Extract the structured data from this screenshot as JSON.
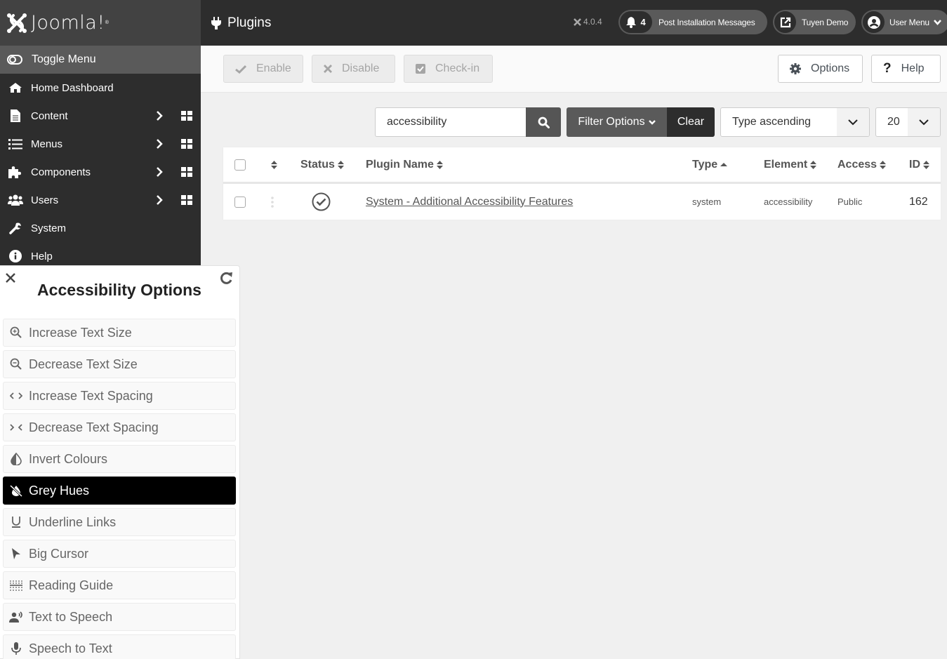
{
  "brand": {
    "name": "Joomla!",
    "reg": "®"
  },
  "sidebar": {
    "toggle_label": "Toggle Menu",
    "items": [
      {
        "label": "Home Dashboard",
        "icon": "home-icon",
        "submenu": false
      },
      {
        "label": "Content",
        "icon": "file-icon",
        "submenu": true
      },
      {
        "label": "Menus",
        "icon": "list-icon",
        "submenu": true
      },
      {
        "label": "Components",
        "icon": "puzzle-icon",
        "submenu": true
      },
      {
        "label": "Users",
        "icon": "users-icon",
        "submenu": true
      },
      {
        "label": "System",
        "icon": "wrench-icon",
        "submenu": false
      },
      {
        "label": "Help",
        "icon": "info-icon",
        "submenu": false
      }
    ]
  },
  "header": {
    "title": "Plugins",
    "title_icon": "plug-icon",
    "version": "4.0.4",
    "post_install": {
      "count": "4",
      "label": "Post Installation Messages"
    },
    "site_link": "Tuyen Demo",
    "user_menu": "User Menu"
  },
  "toolbar": {
    "enable": "Enable",
    "disable": "Disable",
    "checkin": "Check-in",
    "options": "Options",
    "help": "Help"
  },
  "filters": {
    "search_value": "accessibility",
    "filter_options": "Filter Options",
    "clear": "Clear",
    "ordering": "Type ascending",
    "limit": "20"
  },
  "table": {
    "columns": [
      "Status",
      "Plugin Name",
      "Type",
      "Element",
      "Access",
      "ID"
    ],
    "sorted_column": "Type",
    "sort_direction": "ascending",
    "rows": [
      {
        "status": "enabled",
        "name": "System - Additional Accessibility Features",
        "type": "system",
        "element": "accessibility",
        "access": "Public",
        "id": "162"
      }
    ]
  },
  "accessibility": {
    "title": "Accessibility Options",
    "items": [
      {
        "label": "Increase Text Size",
        "icon": "zoom-in-icon",
        "active": false
      },
      {
        "label": "Decrease Text Size",
        "icon": "zoom-out-icon",
        "active": false
      },
      {
        "label": "Increase Text Spacing",
        "icon": "spacing-increase-icon",
        "active": false
      },
      {
        "label": "Decrease Text Spacing",
        "icon": "spacing-decrease-icon",
        "active": false
      },
      {
        "label": "Invert Colours",
        "icon": "invert-icon",
        "active": false
      },
      {
        "label": "Grey Hues",
        "icon": "grey-hues-icon",
        "active": true
      },
      {
        "label": "Underline Links",
        "icon": "underline-icon",
        "active": false
      },
      {
        "label": "Big Cursor",
        "icon": "cursor-icon",
        "active": false
      },
      {
        "label": "Reading Guide",
        "icon": "reading-guide-icon",
        "active": false
      },
      {
        "label": "Text to Speech",
        "icon": "speaker-icon",
        "active": false
      },
      {
        "label": "Speech to Text",
        "icon": "microphone-icon",
        "active": false
      }
    ]
  }
}
